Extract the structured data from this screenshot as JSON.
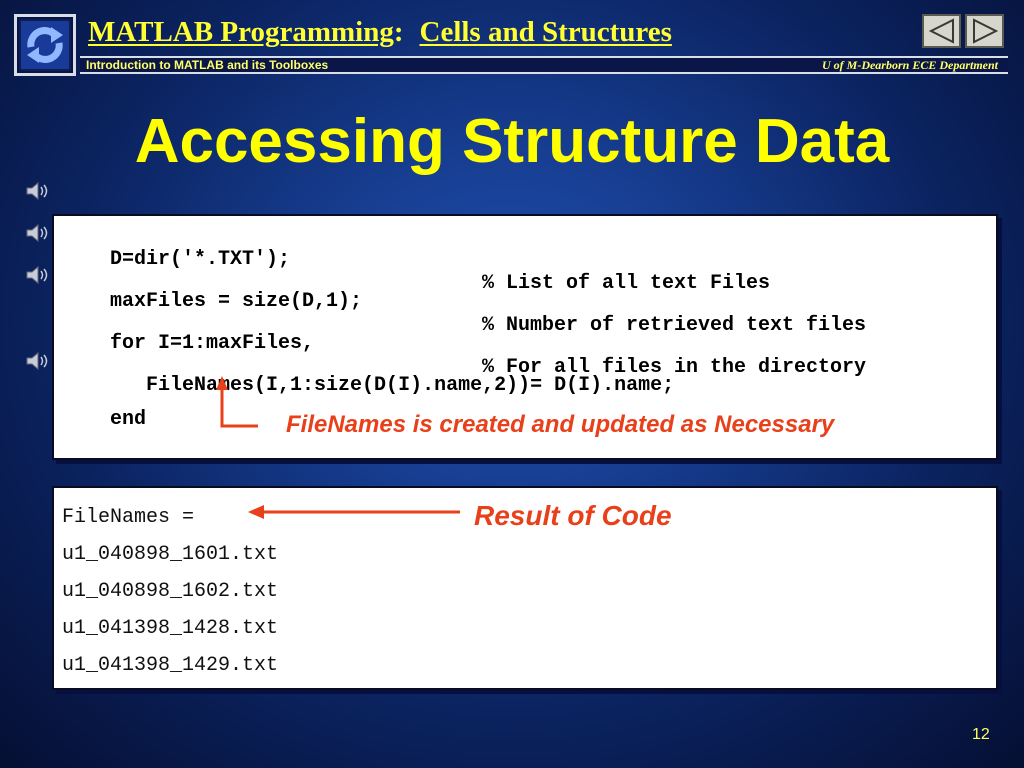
{
  "header": {
    "title_main": "MATLAB Programming",
    "title_colon": ":",
    "title_topic": "Cells and Structures",
    "subtitle_left": "Introduction to MATLAB and its Toolboxes",
    "subtitle_right": "U of M-Dearborn ECE Department",
    "nav_prev_icon": "triangle-left-icon",
    "nav_next_icon": "triangle-right-icon"
  },
  "slide": {
    "title": "Accessing Structure Data",
    "page_number": "12"
  },
  "code_box": {
    "lines": [
      {
        "code": "D=dir('*.TXT');",
        "comment": "% List of all text Files"
      },
      {
        "code": "maxFiles = size(D,1);",
        "comment": "% Number of retrieved text files"
      },
      {
        "code": "for I=1:maxFiles,",
        "comment": "% For all files in the directory"
      },
      {
        "code": "   FileNames(I,1:size(D(I).name,2))= D(I).name;",
        "comment": ""
      },
      {
        "code": "end",
        "comment": ""
      }
    ],
    "annotation": "FileNames is created and updated as Necessary"
  },
  "result_box": {
    "lines": [
      "FileNames =",
      "u1_040898_1601.txt",
      "u1_040898_1602.txt",
      "u1_041398_1428.txt",
      "u1_041398_1429.txt"
    ],
    "label": "Result of Code"
  },
  "colors": {
    "title_yellow": "#ffff00",
    "annotation_orange": "#e8401a",
    "background_blue": "#163c8e"
  },
  "icons": [
    "logo-icon",
    "speaker-icon",
    "triangle-left-icon",
    "triangle-right-icon"
  ]
}
